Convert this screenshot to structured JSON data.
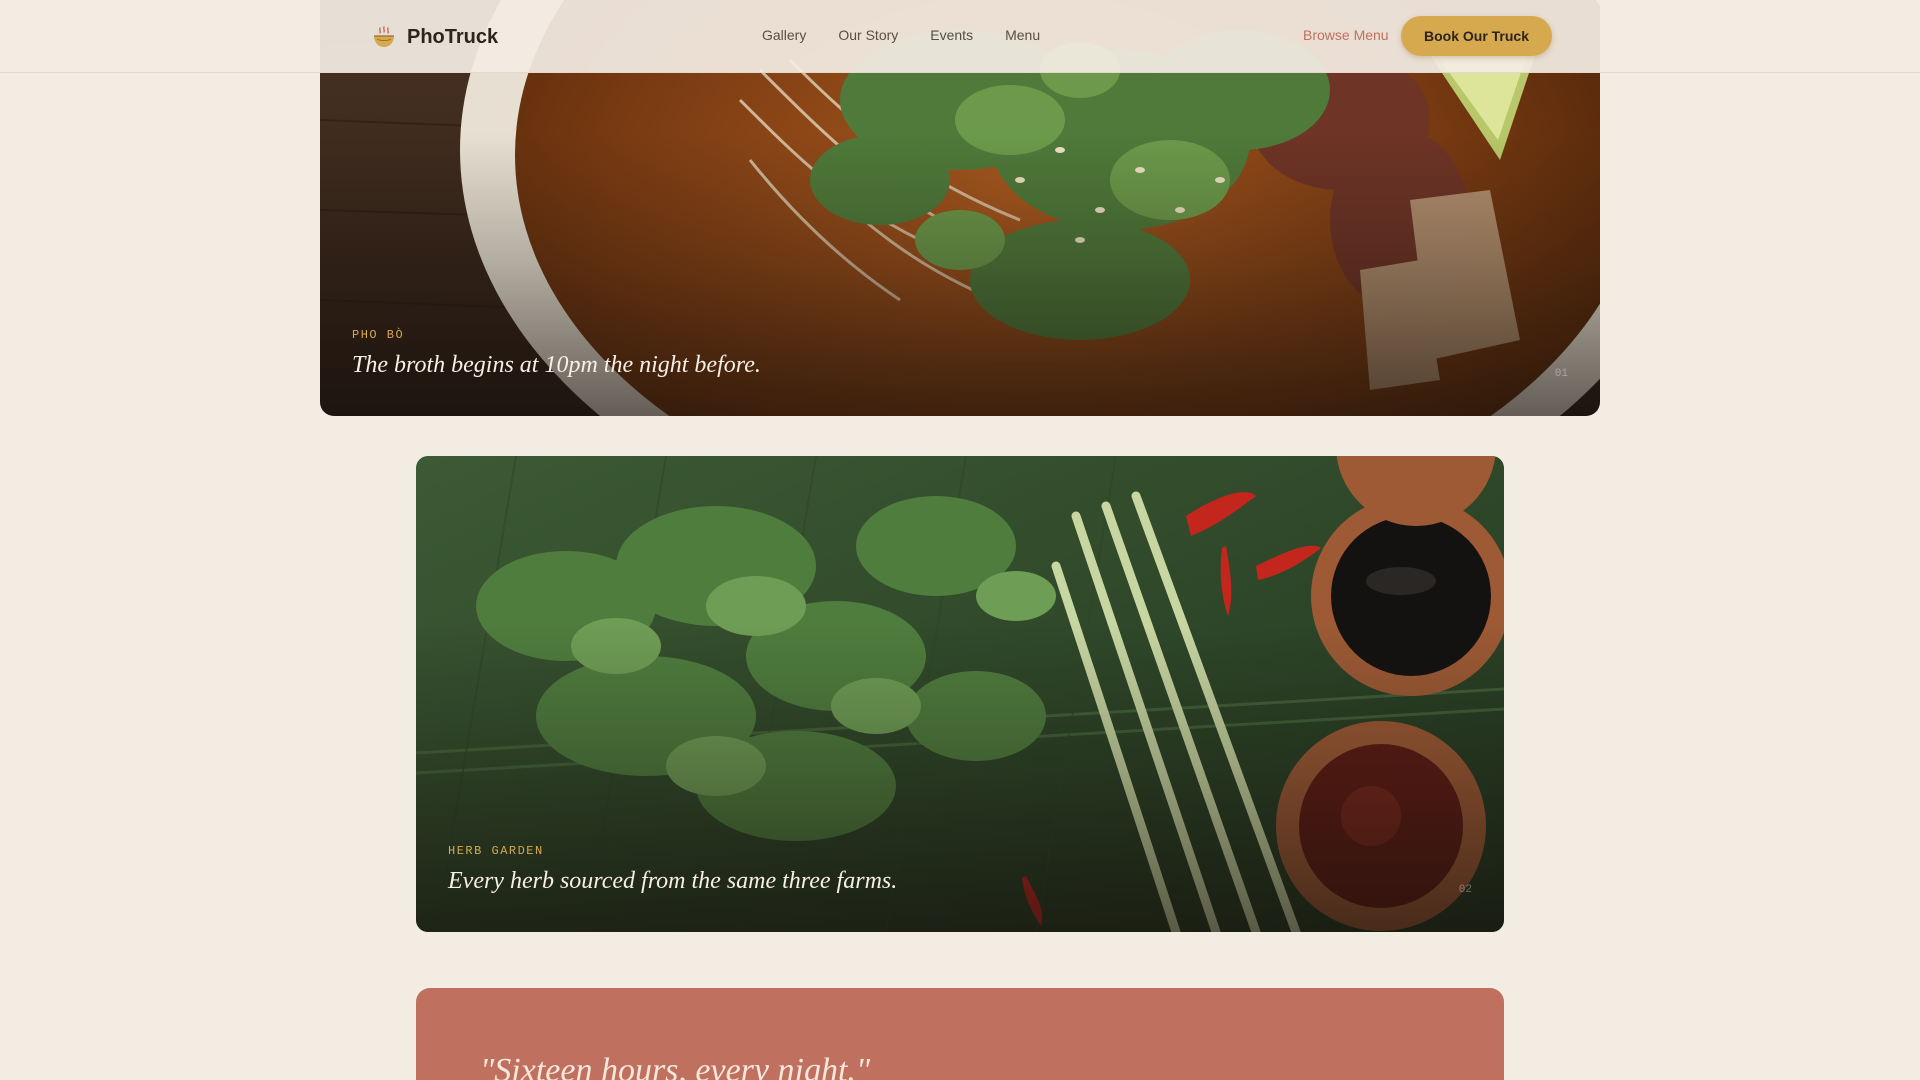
{
  "brand": {
    "name": "PhoTruck",
    "icon": "pho-bowl-icon"
  },
  "nav": {
    "items": [
      {
        "label": "Gallery"
      },
      {
        "label": "Our Story"
      },
      {
        "label": "Events"
      },
      {
        "label": "Menu"
      }
    ],
    "browse_label": "Browse Menu",
    "book_label": "Book Our Truck"
  },
  "colors": {
    "background": "#f3ece3",
    "accent_gold": "#d6a94f",
    "accent_terracotta": "#c0705f",
    "text_dark": "#2f241c"
  },
  "gallery": [
    {
      "kicker": "PHO BÒ",
      "caption": "The broth begins at 10pm the night before.",
      "index": "01"
    },
    {
      "kicker": "HERB GARDEN",
      "caption": "Every herb sourced from the same three farms.",
      "index": "02"
    }
  ],
  "quote": {
    "text": "\"Sixteen hours, every night.\""
  }
}
